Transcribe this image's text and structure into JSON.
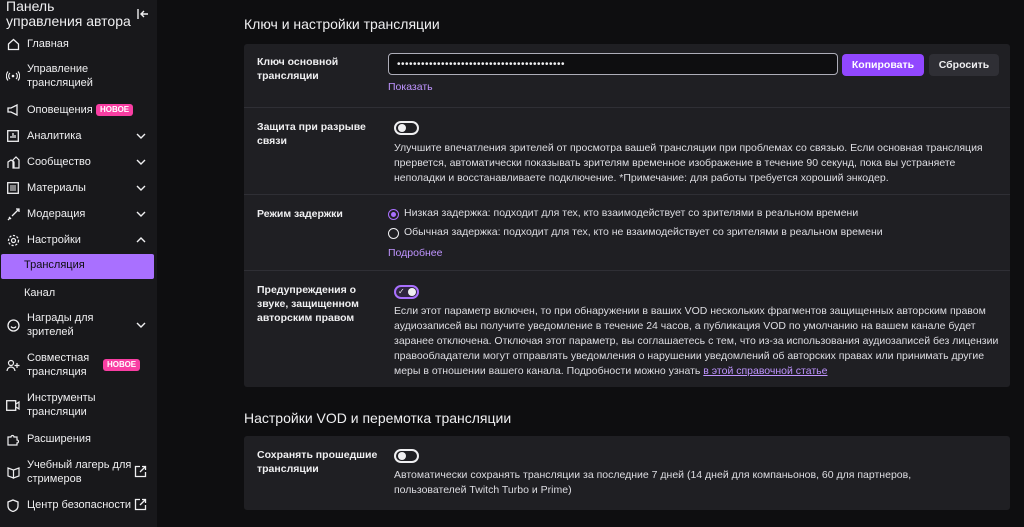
{
  "sidebar": {
    "title": "Панель управления автора",
    "items": [
      {
        "label": "Главная",
        "icon": "home-icon"
      },
      {
        "label": "Управление трансляцией",
        "icon": "broadcast-icon"
      },
      {
        "label": "Оповещения",
        "icon": "megaphone-icon",
        "badge": "НОВОЕ"
      },
      {
        "label": "Аналитика",
        "icon": "analytics-icon"
      },
      {
        "label": "Сообщество",
        "icon": "community-icon"
      },
      {
        "label": "Материалы",
        "icon": "content-icon"
      },
      {
        "label": "Модерация",
        "icon": "sword-icon"
      },
      {
        "label": "Настройки",
        "icon": "gear-icon"
      },
      {
        "label": "Награды для зрителей",
        "icon": "rewards-icon"
      },
      {
        "label": "Совместная трансляция",
        "icon": "add-user-icon",
        "badge": "НОВОЕ"
      },
      {
        "label": "Инструменты трансляции",
        "icon": "camera-icon"
      },
      {
        "label": "Расширения",
        "icon": "puzzle-icon"
      },
      {
        "label": "Учебный лагерь для стримеров",
        "icon": "book-icon"
      },
      {
        "label": "Центр безопасности",
        "icon": "shield-icon"
      }
    ],
    "settings_sub": [
      "Трансляция",
      "Канал"
    ]
  },
  "stream_section": {
    "title": "Ключ и настройки трансляции",
    "key_label": "Ключ основной трансляции",
    "key_value": "••••••••••••••••••••••••••••••••••••••••••",
    "copy_button": "Копировать",
    "reset_button": "Сбросить",
    "show_link": "Показать",
    "disconnect_label": "Защита при разрыве связи",
    "disconnect_desc": "Улучшите впечатления зрителей от просмотра вашей трансляции при проблемах со связью. Если основная трансляция прервется, автоматически показывать зрителям временное изображение в течение 90 секунд, пока вы устраняете неполадки и восстанавливаете подключение. *Примечание: для работы требуется хороший энкодер.",
    "latency_label": "Режим задержки",
    "latency_low": "Низкая задержка: подходит для тех, кто взаимодействует со зрителями в реальном времени",
    "latency_normal": "Обычная задержка: подходит для тех, кто не взаимодействует со зрителями в реальном времени",
    "latency_more": "Подробнее",
    "audio_label": "Предупреждения о звуке, защищенном авторским правом",
    "audio_desc": "Если этот параметр включен, то при обнаружении в ваших VOD нескольких фрагментов защищенных авторским правом аудиозаписей вы получите уведомление в течение 24 часов, а публикация VOD по умолчанию на вашем канале будет заранее отключена. Отключая этот параметр, вы соглашаетесь с тем, что из-за использования аудиозаписей без лицензии правообладатели могут отправлять уведомления о нарушении уведомлений об авторских правах или принимать другие меры в отношении вашего канала. Подробности можно узнать ",
    "audio_link": "в этой справочной статье"
  },
  "vod_section": {
    "title": "Настройки VOD и перемотка трансляции",
    "save_label": "Сохранять прошедшие трансляции",
    "save_desc": "Автоматически сохранять трансляции за последние 7 дней (14 дней для компаньонов, 60 для партнеров, пользователей Twitch Turbo и Prime)"
  },
  "colors": {
    "accent": "#9147ff",
    "active": "#a970ff",
    "badge": "#f93ea3"
  }
}
